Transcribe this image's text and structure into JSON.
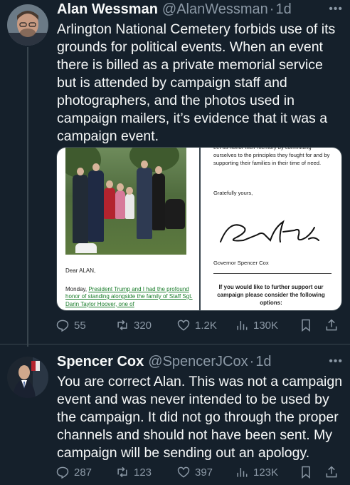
{
  "tweets": [
    {
      "author": {
        "name": "Alan Wessman",
        "handle": "@AlanWessman",
        "time": "1d"
      },
      "text": "Arlington National Cemetery forbids use of its grounds for political events. When an event there is billed as a private memorial service but is attended by campaign staff and photographers, and the photos used in campaign mailers, it’s evidence that it was a campaign event.",
      "media": {
        "left": {
          "greeting": "Dear ALAN,",
          "body_prefix": "Monday, ",
          "body_link": "President Trump and I had the profound honor of standing alongside the family of Staff Sgt. Darin Taylor Hoover, one of"
        },
        "right": {
          "top_text": "Let us honor their memory by committing ourselves to the principles they fought for and by supporting their families in their time of need.",
          "closing": "Gratefully yours,",
          "signer": "Governor Spencer Cox",
          "support_text": "If you would like to further support our campaign please consider the following options:"
        }
      },
      "stats": {
        "replies": "55",
        "reposts": "320",
        "likes": "1.2K",
        "views": "130K"
      }
    },
    {
      "author": {
        "name": "Spencer Cox",
        "handle": "@SpencerJCox",
        "time": "1d"
      },
      "text": "You are correct Alan. This was not a campaign event and was never intended to be used by the campaign. It did not go through the proper channels and should not have been sent. My campaign will be sending out an apology.",
      "stats": {
        "replies": "287",
        "reposts": "123",
        "likes": "397",
        "views": "123K"
      }
    }
  ],
  "ui": {
    "more_label": "•••",
    "separator": "·"
  },
  "colors": {
    "background": "#15202b",
    "text": "#f7f9f9",
    "secondary": "#8b98a5",
    "border": "#38444d",
    "link_green": "#1a7d2b"
  },
  "icons": [
    "reply-icon",
    "repost-icon",
    "like-icon",
    "views-icon",
    "bookmark-icon",
    "share-icon",
    "more-icon"
  ]
}
